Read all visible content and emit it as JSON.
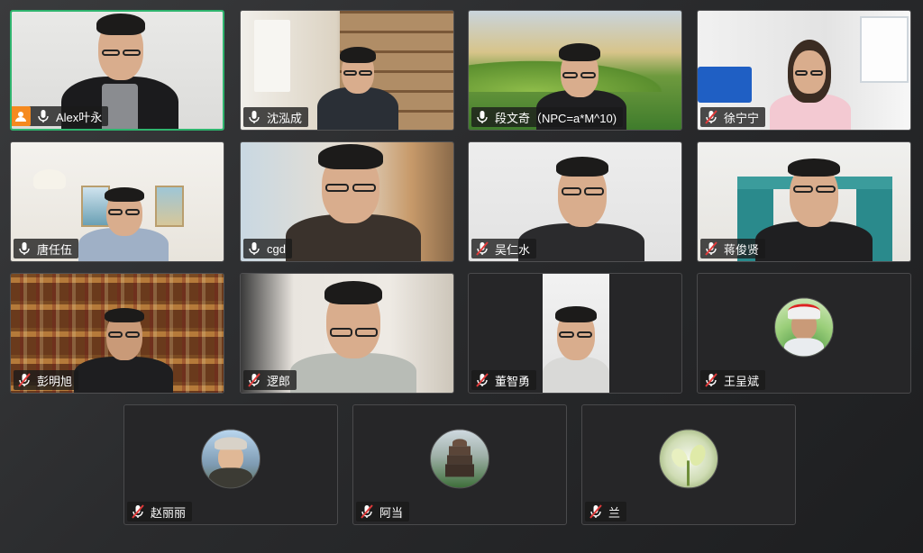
{
  "participants": [
    {
      "name": "Alex叶永",
      "mic": "on",
      "host": true,
      "active": true
    },
    {
      "name": "沈泓成",
      "mic": "on"
    },
    {
      "name": "段文奇（NPC=a*M^10)",
      "mic": "on"
    },
    {
      "name": "徐宁宁",
      "mic": "muted"
    },
    {
      "name": "唐任伍",
      "mic": "on"
    },
    {
      "name": "cgd",
      "mic": "on"
    },
    {
      "name": "吴仁水",
      "mic": "muted"
    },
    {
      "name": "蒋俊贤",
      "mic": "muted"
    },
    {
      "name": "彭明旭",
      "mic": "muted"
    },
    {
      "name": "逻郎",
      "mic": "muted"
    },
    {
      "name": "董智勇",
      "mic": "muted"
    },
    {
      "name": "王呈斌",
      "mic": "muted"
    },
    {
      "name": "赵丽丽",
      "mic": "muted"
    },
    {
      "name": "阿当",
      "mic": "muted"
    },
    {
      "name": "兰",
      "mic": "muted"
    }
  ],
  "colors": {
    "active_border": "#2fb46e",
    "host_badge": "#f58a1f",
    "muted_slash": "#e03a3a"
  },
  "icons": {
    "mic_on": "microphone-icon",
    "mic_muted": "microphone-muted-icon",
    "host": "host-user-icon"
  }
}
